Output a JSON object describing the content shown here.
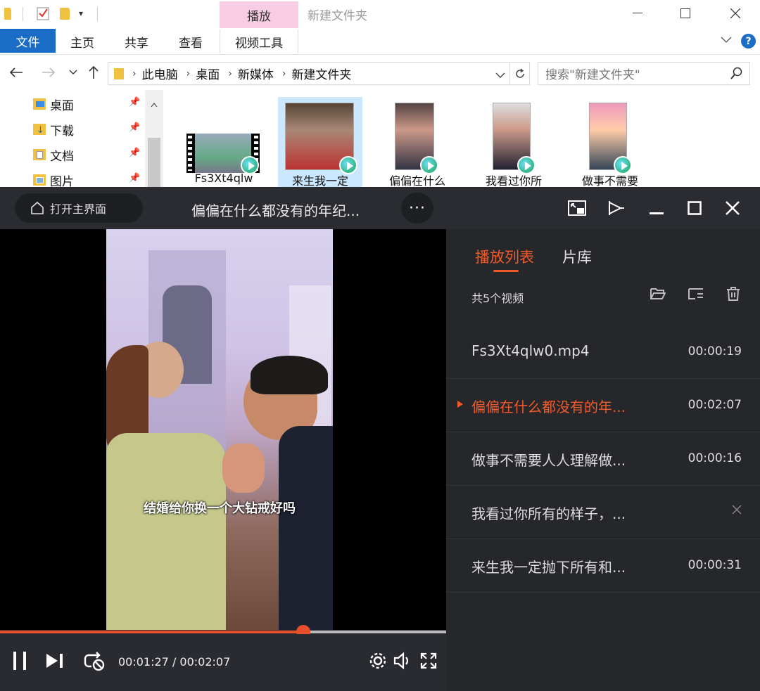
{
  "explorer": {
    "window_title": "新建文件夹",
    "context_tab": "播放",
    "ribbon_tabs": [
      "文件",
      "主页",
      "共享",
      "查看",
      "视频工具"
    ],
    "breadcrumb": [
      "此电脑",
      "桌面",
      "新媒体",
      "新建文件夹"
    ],
    "search_placeholder": "搜索\"新建文件夹\"",
    "nav_items": [
      {
        "label": "桌面",
        "icon": "desktop-folder-icon"
      },
      {
        "label": "下载",
        "icon": "download-folder-icon"
      },
      {
        "label": "文档",
        "icon": "documents-folder-icon"
      },
      {
        "label": "图片",
        "icon": "pictures-folder-icon"
      }
    ],
    "files": [
      {
        "name": "Fs3Xt4qlw",
        "selected": false
      },
      {
        "name": "来生我一定",
        "selected": true
      },
      {
        "name": "偏偏在什么",
        "selected": false
      },
      {
        "name": "我看过你所",
        "selected": false
      },
      {
        "name": "做事不需要",
        "selected": false
      }
    ]
  },
  "player": {
    "home_label": "打开主界面",
    "title": "偏偏在什么都没有的年纪...",
    "more_label": "···",
    "subtitle": "结婚给你换一个大钻戒好吗",
    "current_time": "00:01:27",
    "total_time": "00:02:07",
    "time_text": "00:01:27 / 00:02:07",
    "progress": 0.68
  },
  "sidebar": {
    "tab_playlist": "播放列表",
    "tab_library": "片库",
    "count": "共5个视频",
    "items": [
      {
        "name": "Fs3Xt4qlw0.mp4",
        "duration": "00:00:19",
        "active": false,
        "hover": false
      },
      {
        "name": "偏偏在什么都没有的年...",
        "duration": "00:02:07",
        "active": true,
        "hover": false
      },
      {
        "name": "做事不需要人人理解做...",
        "duration": "00:00:16",
        "active": false,
        "hover": false
      },
      {
        "name": "我看过你所有的样子，...",
        "duration": "",
        "active": false,
        "hover": true
      },
      {
        "name": "来生我一定抛下所有和...",
        "duration": "00:00:31",
        "active": false,
        "hover": false
      }
    ]
  },
  "colors": {
    "accent": "#f05a28",
    "file_tab": "#1a6dc6",
    "context_tab": "#f8cde3",
    "player_bg": "#2a2b30"
  }
}
